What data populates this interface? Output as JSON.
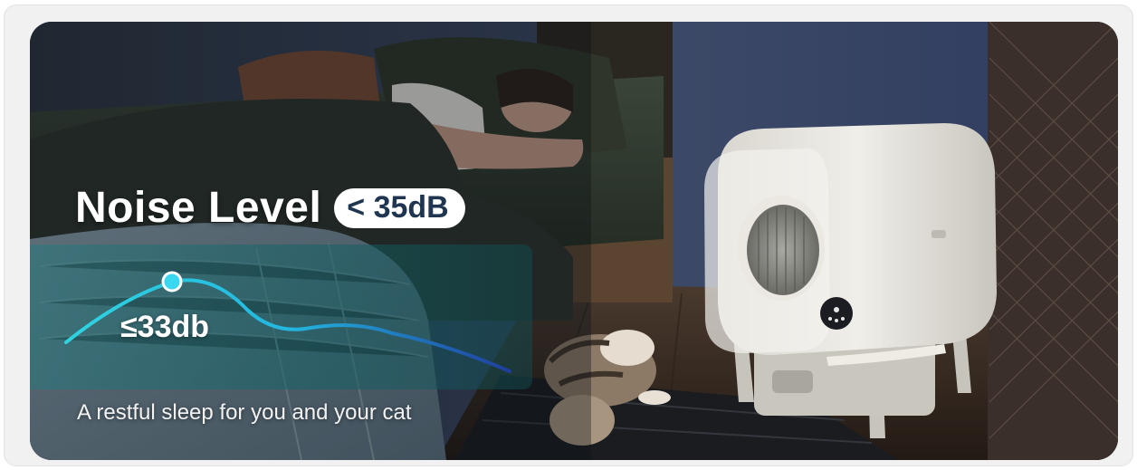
{
  "banner": {
    "title": "Noise Level",
    "badge": "< 35dB",
    "measurement": "≤33db",
    "subtitle": "A restful sleep for you and your cat"
  },
  "colors": {
    "frame": "#f1f1f1",
    "badge_text": "#1f3550",
    "wave_start": "#2fd4e0",
    "wave_end": "#1e3f9e",
    "panel": "#1d6f74"
  }
}
